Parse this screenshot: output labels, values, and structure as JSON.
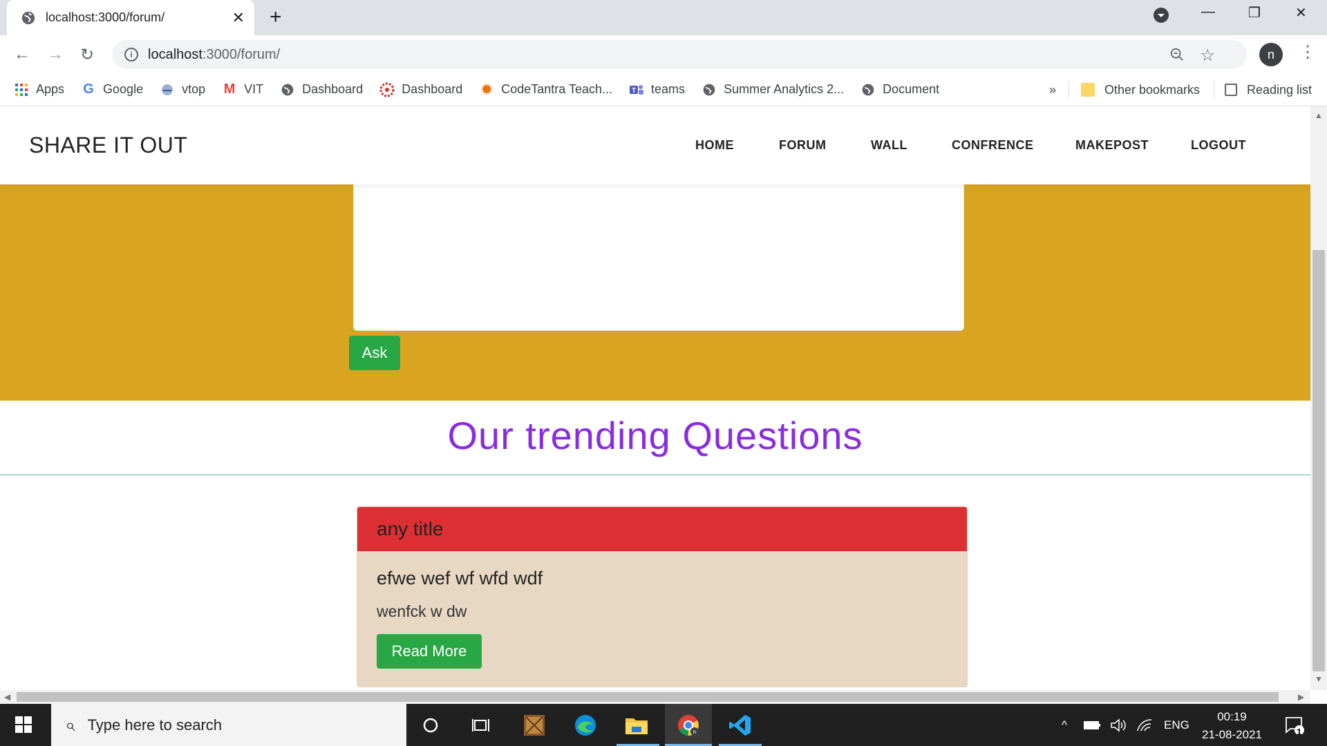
{
  "browser": {
    "tab_title": "localhost:3000/forum/",
    "url_host": "localhost",
    "url_rest": ":3000/forum/",
    "bookmarks": [
      {
        "label": "Apps",
        "icon": "apps-grid-icon"
      },
      {
        "label": "Google",
        "icon": "google-icon"
      },
      {
        "label": "vtop",
        "icon": "vtop-icon"
      },
      {
        "label": "VIT",
        "icon": "gmail-icon"
      },
      {
        "label": "Dashboard",
        "icon": "globe-icon"
      },
      {
        "label": "Dashboard",
        "icon": "dashboard-icon"
      },
      {
        "label": "CodeTantra Teach...",
        "icon": "codetantra-icon"
      },
      {
        "label": "teams",
        "icon": "teams-icon"
      },
      {
        "label": "Summer Analytics 2...",
        "icon": "globe-icon"
      },
      {
        "label": "Document",
        "icon": "globe-icon"
      }
    ],
    "overflow": "»",
    "other_bookmarks": "Other bookmarks",
    "reading_list": "Reading list",
    "avatar_letter": "n"
  },
  "site": {
    "brand": "SHARE IT OUT",
    "nav": [
      "HOME",
      "FORUM",
      "WALL",
      "CONFRENCE",
      "MAKEPOST",
      "LOGOUT"
    ],
    "ask_label": "Ask",
    "trending_heading": "Our trending Questions",
    "card": {
      "header": "any title",
      "title": "efwe wef wf wfd wdf",
      "text": "wenfck w dw",
      "button": "Read More"
    }
  },
  "taskbar": {
    "search_placeholder": "Type here to search",
    "lang": "ENG",
    "time": "00:19",
    "date": "21-08-2021",
    "notifications": "1"
  },
  "colors": {
    "gold": "#d9a520",
    "heading": "#8a2be2",
    "card_header": "#dc3035",
    "card_body": "#e8d8c3",
    "button": "#28a745"
  }
}
